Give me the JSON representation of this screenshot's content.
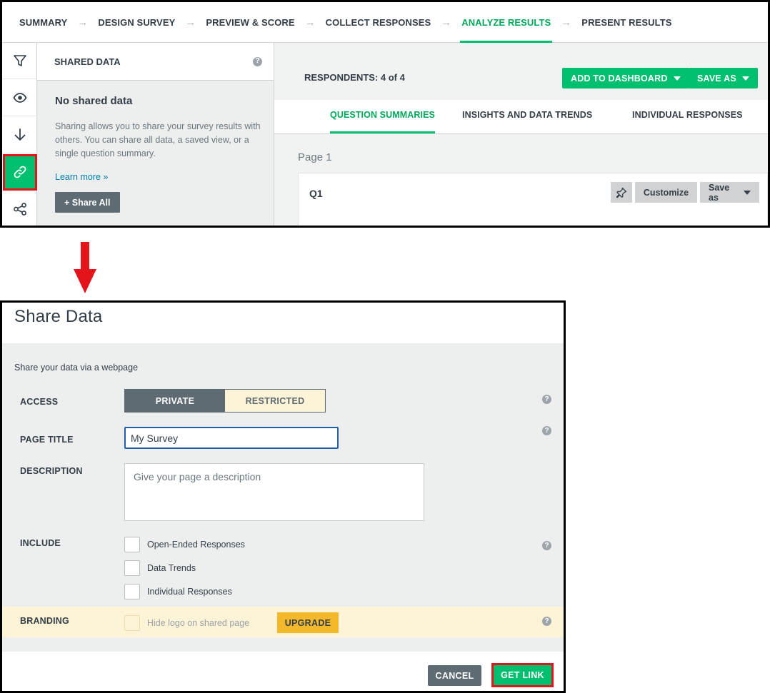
{
  "nav": {
    "steps": [
      {
        "label": "SUMMARY"
      },
      {
        "label": "DESIGN SURVEY"
      },
      {
        "label": "PREVIEW & SCORE"
      },
      {
        "label": "COLLECT RESPONSES"
      },
      {
        "label": "ANALYZE RESULTS",
        "active": true
      },
      {
        "label": "PRESENT RESULTS"
      }
    ],
    "arrow_glyph": "→"
  },
  "rail": {
    "icons": [
      "filter-icon",
      "eye-icon",
      "download-arrow-icon",
      "link-icon",
      "share-network-icon"
    ],
    "active": "link-icon",
    "active_color": "#00bf6f",
    "highlight_color": "#e4141b"
  },
  "shared_panel": {
    "title": "SHARED DATA",
    "help": "?",
    "empty_title": "No shared data",
    "empty_desc": "Sharing allows you to share your survey results with others. You can share all data, a saved view, or a single question summary.",
    "learn_more": "Learn more »",
    "share_all": "+ Share All"
  },
  "results": {
    "respondents": "RESPONDENTS: 4 of 4",
    "add_to_dashboard": "ADD TO DASHBOARD",
    "save_as": "SAVE AS",
    "tabs": [
      {
        "label": "QUESTION SUMMARIES",
        "active": true
      },
      {
        "label": "INSIGHTS AND DATA TRENDS"
      },
      {
        "label": "INDIVIDUAL RESPONSES"
      }
    ],
    "page_label": "Page 1",
    "question": {
      "label": "Q1",
      "customize": "Customize",
      "save_as": "Save as"
    }
  },
  "modal": {
    "title": "Share Data",
    "intro": "Share your data via a webpage",
    "access": {
      "label": "ACCESS",
      "options": [
        "PRIVATE",
        "RESTRICTED"
      ],
      "selected": "PRIVATE"
    },
    "page_title": {
      "label": "PAGE TITLE",
      "value": "My Survey"
    },
    "description": {
      "label": "DESCRIPTION",
      "placeholder": "Give your page a description"
    },
    "include": {
      "label": "INCLUDE",
      "options": [
        "Open-Ended Responses",
        "Data Trends",
        "Individual Responses"
      ]
    },
    "branding": {
      "label": "BRANDING",
      "option": "Hide logo on shared page",
      "upgrade": "UPGRADE"
    },
    "help": "?",
    "cancel": "CANCEL",
    "get_link": "GET LINK"
  },
  "colors": {
    "accent_green": "#00bf6f",
    "slate": "#5e6b73",
    "highlight_red": "#e4141b",
    "upgrade_yellow": "#f4b92b"
  }
}
